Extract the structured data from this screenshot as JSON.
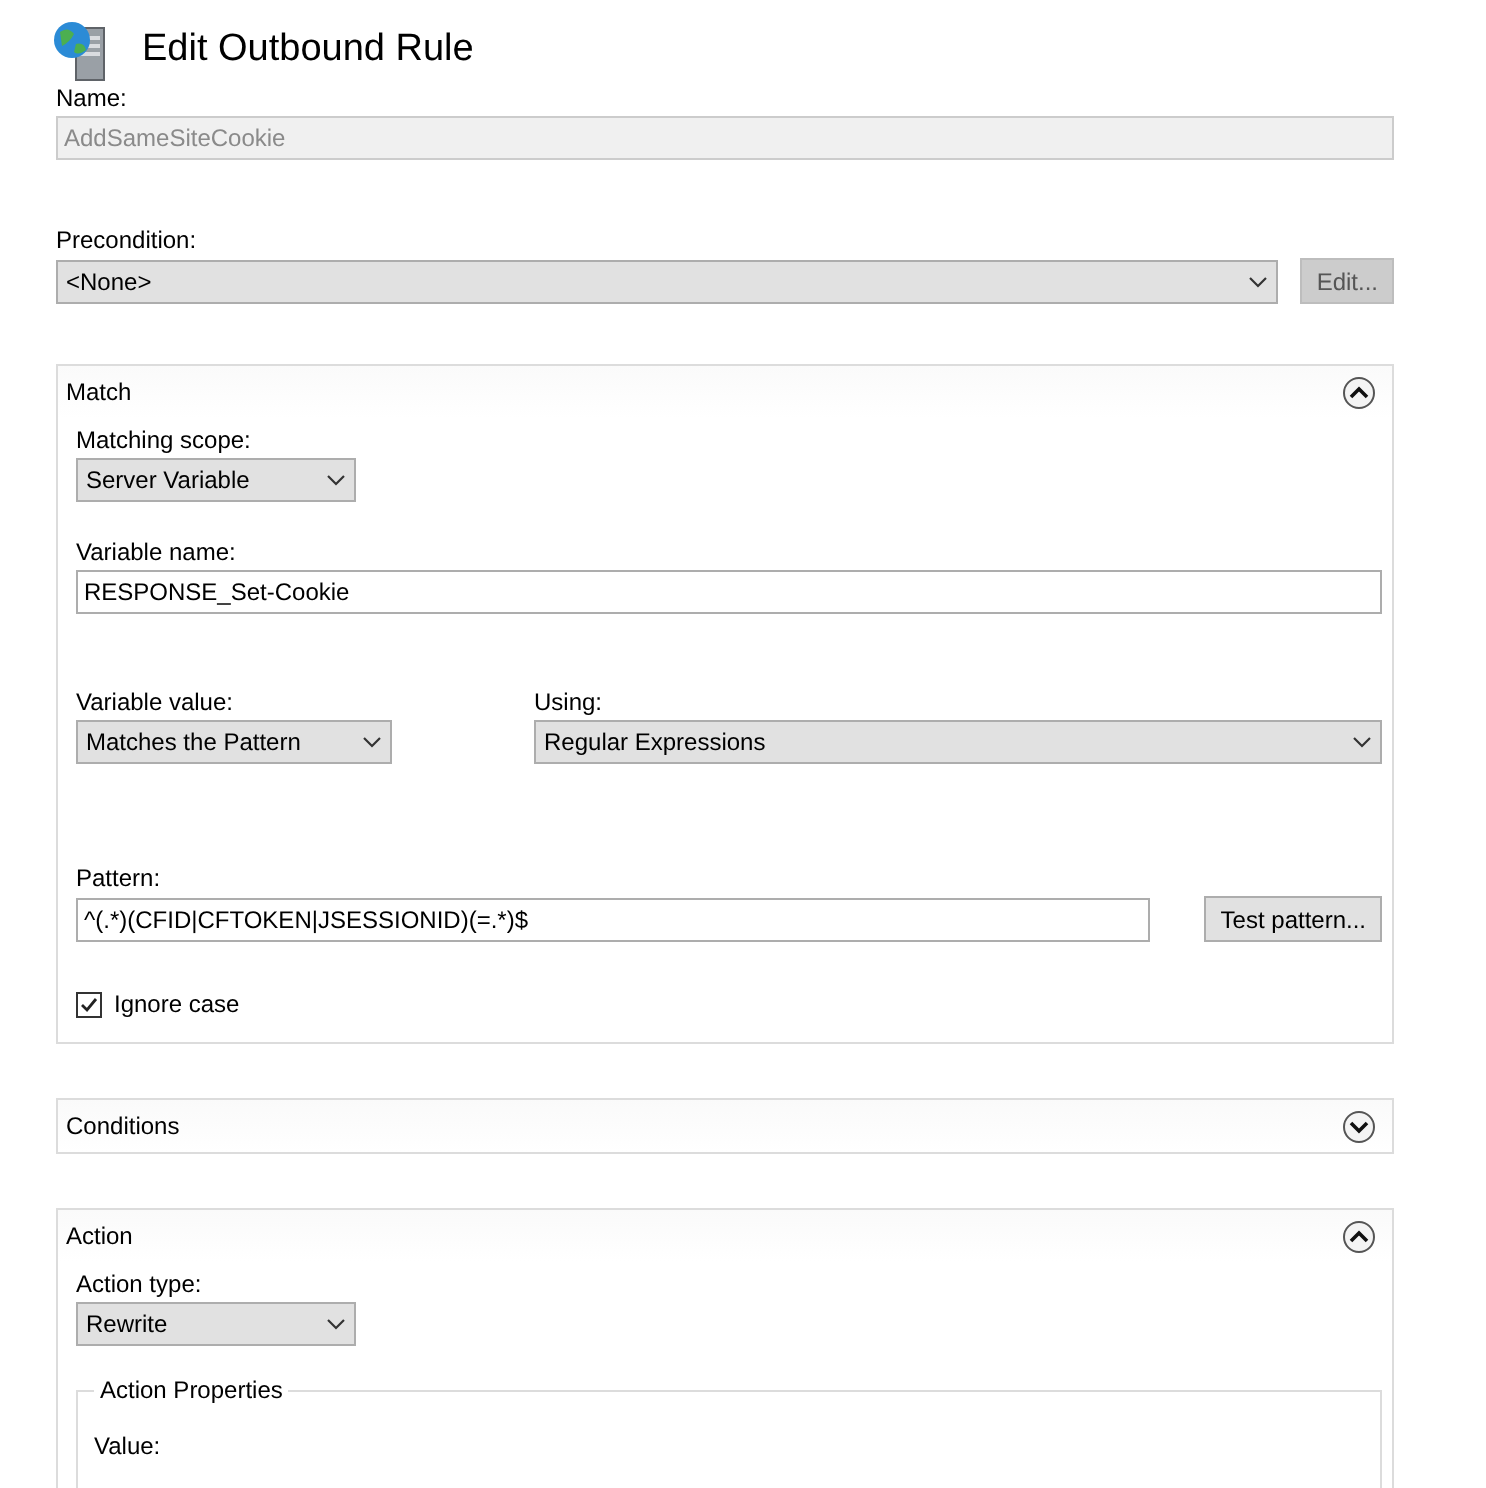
{
  "window": {
    "title": "Edit Outbound Rule"
  },
  "name": {
    "label": "Name:",
    "value": "AddSameSiteCookie",
    "disabled": true
  },
  "precondition": {
    "label": "Precondition:",
    "value": "<None>",
    "button": "Edit..."
  },
  "match": {
    "title": "Match",
    "expanded": true,
    "matching_scope": {
      "label": "Matching scope:",
      "value": "Server Variable"
    },
    "variable_name": {
      "label": "Variable name:",
      "value": "RESPONSE_Set-Cookie"
    },
    "variable_value": {
      "label": "Variable value:",
      "value": "Matches the Pattern"
    },
    "using": {
      "label": "Using:",
      "value": "Regular Expressions"
    },
    "pattern": {
      "label": "Pattern:",
      "value": "^(.*)(CFID|CFTOKEN|JSESSIONID)(=.*)$",
      "button": "Test pattern..."
    },
    "ignore_case": {
      "label": "Ignore case",
      "checked": true
    }
  },
  "conditions": {
    "title": "Conditions",
    "expanded": false
  },
  "action": {
    "title": "Action",
    "expanded": true,
    "action_type": {
      "label": "Action type:",
      "value": "Rewrite"
    },
    "properties": {
      "title": "Action Properties",
      "value_label": "Value:"
    }
  }
}
